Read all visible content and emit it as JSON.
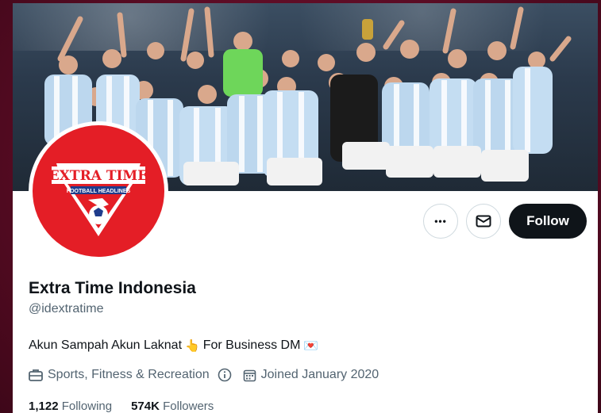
{
  "profile": {
    "name": "Extra Time Indonesia",
    "handle": "@idextratime",
    "bio_text": "Akun Sampah Akun Laknat",
    "bio_emoji_1": "👆",
    "bio_text_2": "For Business DM",
    "bio_emoji_2": "💌",
    "category": "Sports, Fitness & Recreation",
    "joined": "Joined January 2020",
    "following_count": "1,122",
    "following_label": "Following",
    "followers_count": "574K",
    "followers_label": "Followers"
  },
  "avatar": {
    "logo_top": "EXTRA TIME",
    "logo_sub": "FOOTBALL HEADLINES"
  },
  "actions": {
    "more_label": "•••",
    "follow_label": "Follow"
  },
  "colors": {
    "brand_red": "#e41e26",
    "follow_bg": "#0f1419",
    "background": "#5a0c24"
  },
  "icons": {
    "more": "more-icon",
    "message": "envelope-icon",
    "category": "briefcase-icon",
    "info": "info-icon",
    "joined": "calendar-icon"
  }
}
